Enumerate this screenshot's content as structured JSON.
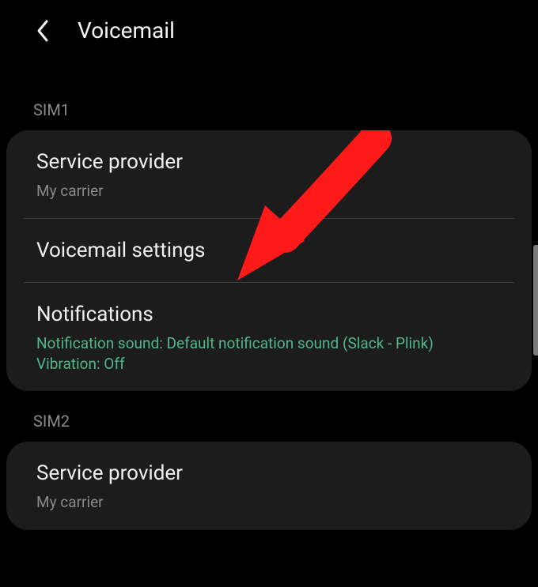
{
  "header": {
    "title": "Voicemail"
  },
  "sim1": {
    "label": "SIM1",
    "items": [
      {
        "title": "Service provider",
        "subtitle": "My carrier"
      },
      {
        "title": "Voicemail settings",
        "subtitle": null
      },
      {
        "title": "Notifications",
        "subtitle_line1": "Notification sound: Default notification sound (Slack - Plink)",
        "subtitle_line2": "Vibration: Off"
      }
    ]
  },
  "sim2": {
    "label": "SIM2",
    "items": [
      {
        "title": "Service provider",
        "subtitle": "My carrier"
      }
    ]
  }
}
